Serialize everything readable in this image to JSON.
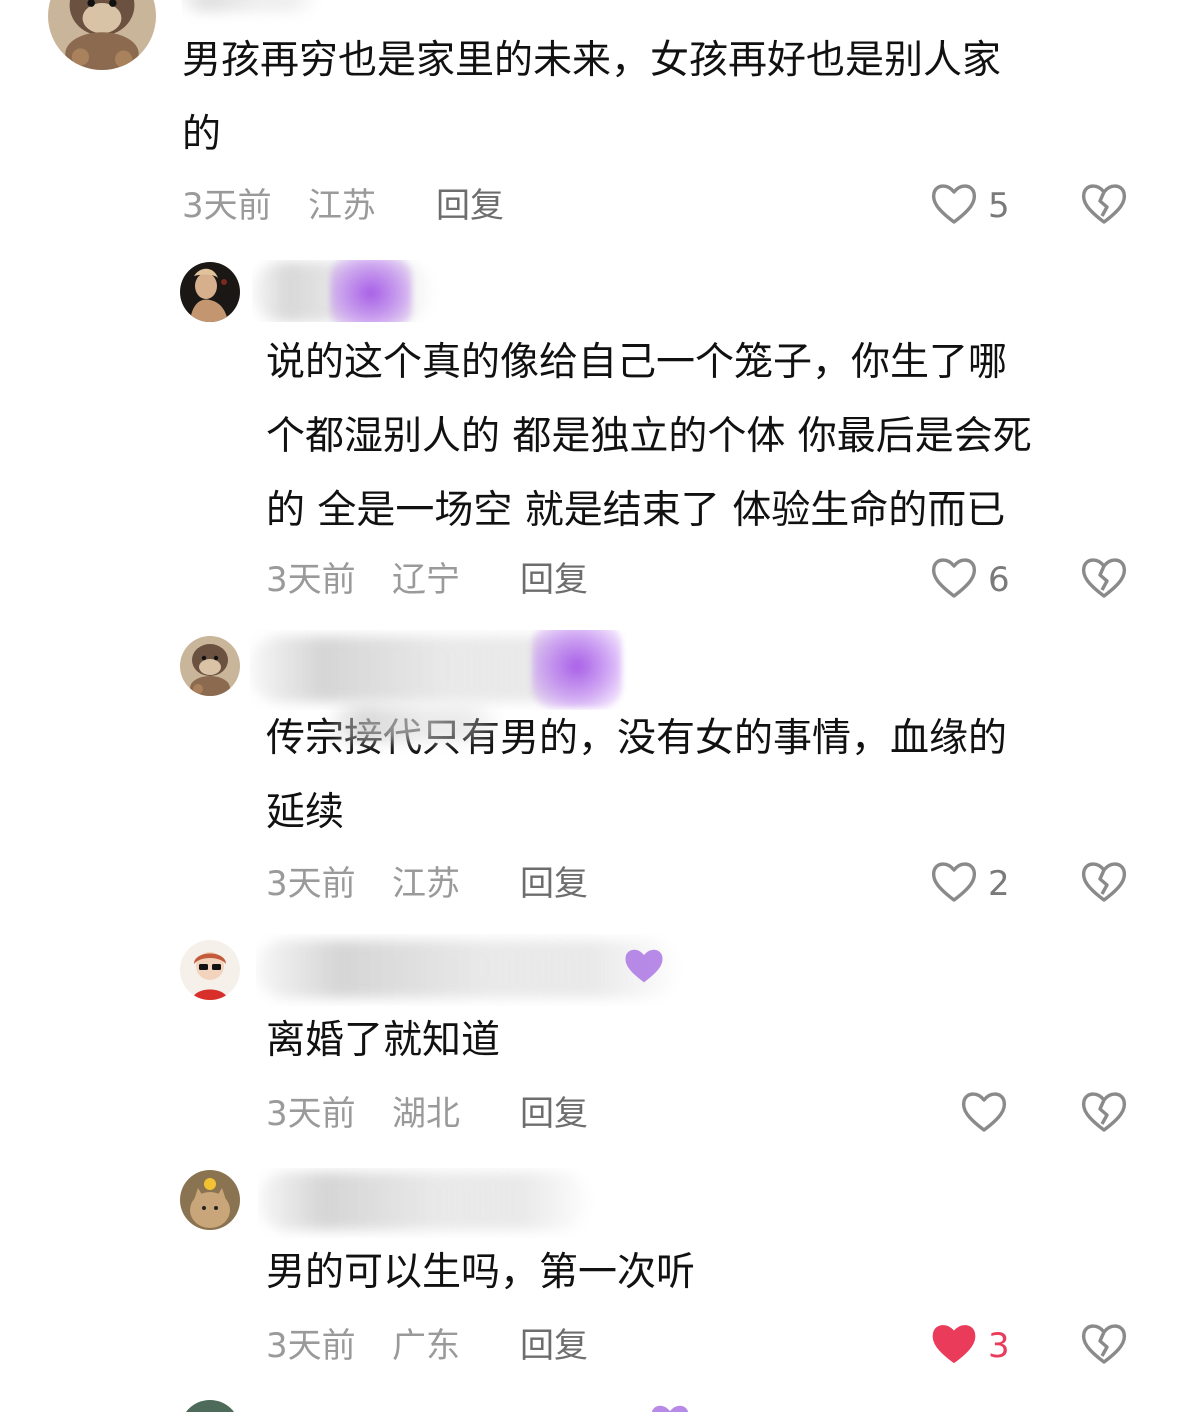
{
  "colors": {
    "liked_red": "#ea3b5a",
    "meta_gray": "#9a9a9a",
    "text": "#111111",
    "icon_gray": "#8a8a8a"
  },
  "comments": [
    {
      "username": "",
      "text_lines": [
        "男孩再穷也是家里的未来，女孩再好也是别人家",
        "的"
      ],
      "time": "3天前",
      "location": "江苏",
      "reply_label": "回复",
      "likes": "5",
      "liked": false
    },
    {
      "username": "",
      "text_lines": [
        "说的这个真的像给自己一个笼子，你生了哪",
        "个都湿别人的 都是独立的个体 你最后是会死",
        "的 全是一场空 就是结束了 体验生命的而已"
      ],
      "time": "3天前",
      "location": "辽宁",
      "reply_label": "回复",
      "likes": "6",
      "liked": false
    },
    {
      "username": "",
      "text_lines": [
        "传宗接代只有男的，没有女的事情，血缘的",
        "延续"
      ],
      "time": "3天前",
      "location": "江苏",
      "reply_label": "回复",
      "likes": "2",
      "liked": false
    },
    {
      "username": "",
      "text_lines": [
        "离婚了就知道"
      ],
      "time": "3天前",
      "location": "湖北",
      "reply_label": "回复",
      "likes": "",
      "liked": false
    },
    {
      "username": "",
      "text_lines": [
        "男的可以生吗，第一次听"
      ],
      "time": "3天前",
      "location": "广东",
      "reply_label": "回复",
      "likes": "3",
      "liked": true
    }
  ],
  "icons": {
    "like": "heart-outline-icon",
    "liked": "heart-filled-icon",
    "dislike": "broken-heart-icon"
  }
}
